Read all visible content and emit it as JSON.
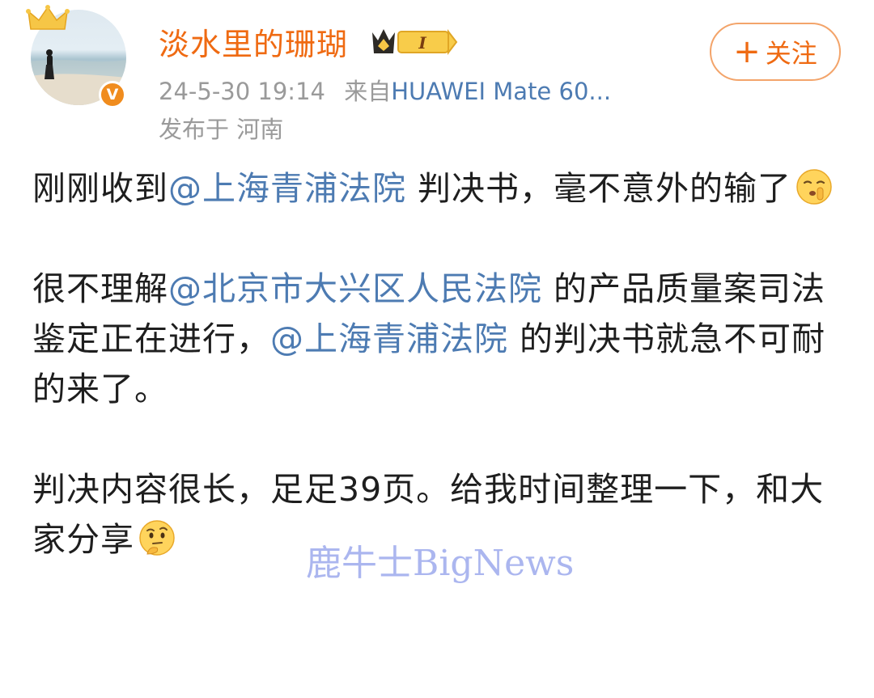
{
  "header": {
    "username": "淡水里的珊瑚",
    "level_badge": "I",
    "verified_mark": "V",
    "timestamp": "24-5-30 19:14",
    "source_prefix": "来自",
    "device": "HUAWEI Mate 60...",
    "location": "发布于 河南",
    "follow_plus": "+",
    "follow_label": "关注",
    "icons": {
      "crown": "crown-icon",
      "level": "vip-level-icon",
      "verified": "verified-badge-icon"
    },
    "colors": {
      "username": "#ef6a12",
      "link": "#4d7bb2",
      "meta": "#9a9a9a",
      "verified": "#f08c1e"
    }
  },
  "post": {
    "p1": {
      "text1": "刚刚收到",
      "mention1": "@上海青浦法院",
      "text2": " 判决书，毫不意外的输了",
      "emoji": "shush-emoji"
    },
    "p2": {
      "text1": "很不理解",
      "mention1": "@北京市大兴区人民法院",
      "text2": " 的产品质量案司法鉴定正在进行，",
      "mention2": "@上海青浦法院",
      "text3": " 的判决书就急不可耐的来了。"
    },
    "p3": {
      "text1": "判决内容很长，足足39页。给我时间整理一下，和大家分享",
      "emoji": "thinking-emoji"
    }
  },
  "watermark": "鹿牛士BigNews"
}
